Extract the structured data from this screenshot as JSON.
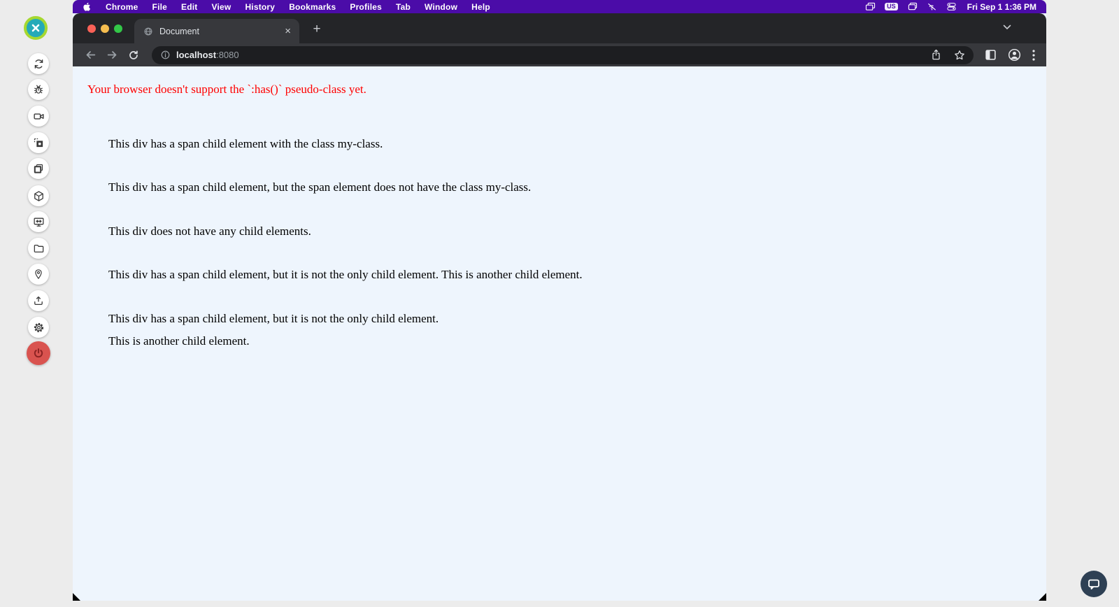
{
  "menu_bar": {
    "app": "Chrome",
    "items": [
      "File",
      "Edit",
      "View",
      "History",
      "Bookmarks",
      "Profiles",
      "Tab",
      "Window",
      "Help"
    ],
    "keyboard_badge": "US",
    "clock": "Fri Sep 1 1:36 PM",
    "status_icons": [
      "screen-mirror-icon",
      "keyboard-badge",
      "stacked-windows-icon",
      "wifi-off-icon",
      "switches-icon"
    ]
  },
  "browser": {
    "tab_title": "Document",
    "tab_close": "×",
    "new_tab": "+",
    "url_host": "localhost",
    "url_port": ":8080",
    "toolbar_icons": [
      "back-icon",
      "forward-icon",
      "reload-icon",
      "info-icon",
      "share-icon",
      "star-icon",
      "side-panel-icon",
      "profile-icon",
      "kebab-menu-icon"
    ]
  },
  "content": {
    "error": "Your browser doesn't support the `:has()` pseudo-class yet.",
    "paragraphs": [
      "This div has a span child element with the class my-class.",
      "This div has a span child element, but the span element does not have the class my-class.",
      "This div does not have any child elements.",
      "This div has a span child element, but it is not the only child element. This is another child element.",
      "This div has a span child element, but it is not the only child element.",
      "This is another child element."
    ]
  },
  "viewer_sidebar": {
    "buttons": [
      "close",
      "sync",
      "debug",
      "screen-record",
      "region-select",
      "screenshots",
      "package",
      "display-resize",
      "files",
      "location",
      "upload",
      "settings",
      "power"
    ]
  },
  "chat": {
    "icon": "chat-bubble-icon"
  },
  "colors": {
    "menubar_purple": "#4b0ca8",
    "tabstrip_dark": "#242528",
    "toolbar_dark": "#37383c",
    "page_bg": "#eef5fd",
    "error_red": "#ff0000",
    "close_teal": "#24aab8",
    "close_ring_green": "#a6d830",
    "power_red": "#d9534f",
    "chat_navy": "#2e4054"
  }
}
